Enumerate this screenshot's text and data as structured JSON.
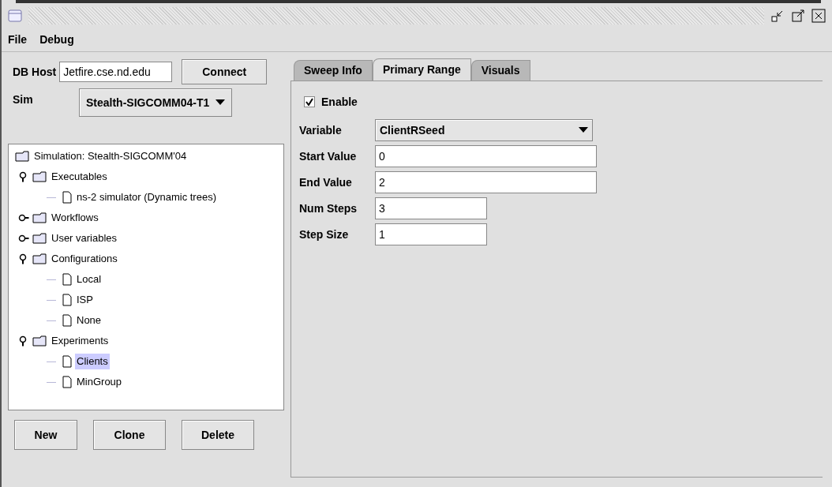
{
  "menu": [
    "File",
    "Debug"
  ],
  "db_host": {
    "label": "DB Host",
    "value": "Jetfire.cse.nd.edu",
    "button": "Connect"
  },
  "sim": {
    "label": "Sim",
    "value": "Stealth-SIGCOMM04-T1"
  },
  "tree": [
    {
      "label": "Simulation: Stealth-SIGCOMM'04",
      "kind": "folder",
      "selected": false,
      "children": [
        {
          "label": "Executables",
          "kind": "folder",
          "expanded": true,
          "selected": false,
          "children": [
            {
              "label": "ns-2 simulator (Dynamic trees)",
              "kind": "leaf",
              "selected": false
            }
          ]
        },
        {
          "label": "Workflows",
          "kind": "folder",
          "expanded": false,
          "selected": false
        },
        {
          "label": "User variables",
          "kind": "folder",
          "expanded": false,
          "selected": false
        },
        {
          "label": "Configurations",
          "kind": "folder",
          "expanded": true,
          "selected": false,
          "children": [
            {
              "label": "Local",
              "kind": "leaf",
              "selected": false
            },
            {
              "label": "ISP",
              "kind": "leaf",
              "selected": false
            },
            {
              "label": "None",
              "kind": "leaf",
              "selected": false
            }
          ]
        },
        {
          "label": "Experiments",
          "kind": "folder",
          "expanded": true,
          "selected": false,
          "children": [
            {
              "label": "Clients",
              "kind": "leaf",
              "selected": true
            },
            {
              "label": "MinGroup",
              "kind": "leaf",
              "selected": false
            }
          ]
        }
      ]
    }
  ],
  "buttons": [
    "New",
    "Clone",
    "Delete"
  ],
  "tabs": [
    {
      "label": "Sweep Info",
      "selected": false
    },
    {
      "label": "Primary Range",
      "selected": true
    },
    {
      "label": "Visuals",
      "selected": false
    }
  ],
  "enable": {
    "label": "Enable",
    "checked": true
  },
  "variable": {
    "label": "Variable",
    "value": "ClientRSeed"
  },
  "fields": [
    {
      "label": "Start Value",
      "value": "0",
      "wide": true
    },
    {
      "label": "End Value",
      "value": "2",
      "wide": true
    },
    {
      "label": "Num Steps",
      "value": "3",
      "wide": false
    },
    {
      "label": "Step Size",
      "value": "1",
      "wide": false
    }
  ]
}
